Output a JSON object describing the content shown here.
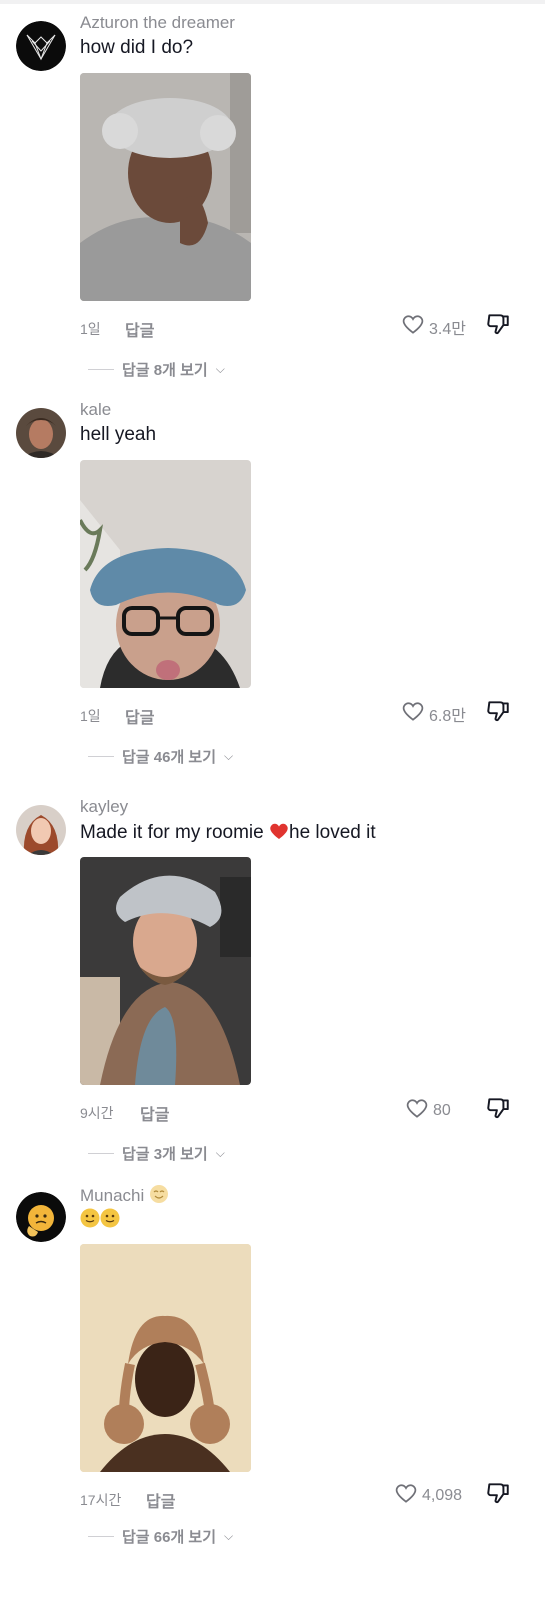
{
  "comments": [
    {
      "username": "Azturon the dreamer",
      "text": "how did I do?",
      "time": "1일",
      "reply_label": "답글",
      "likes": "3.4만",
      "view_replies": "답글 8개 보기",
      "avatar_icon": "wolf-logo-icon",
      "photo_colors": {
        "bg": "#b9b6b2",
        "skin": "#6b4a3a",
        "hat": "#cfcfcf",
        "shirt": "#9a9a9a"
      }
    },
    {
      "username": "kale",
      "text": "hell yeah",
      "time": "1일",
      "reply_label": "답글",
      "likes": "6.8만",
      "view_replies": "답글 46개 보기",
      "avatar_icon": "user-avatar",
      "photo_colors": {
        "bg": "#d7d3cf",
        "skin": "#c9a08c",
        "hat": "#5f8aa8",
        "shirt": "#2c2c2c"
      }
    },
    {
      "username": "kayley",
      "text_before": "Made it for my roomie ",
      "text_after": "he loved it",
      "time": "9시간",
      "reply_label": "답글",
      "likes": "80",
      "view_replies": "답글 3개 보기",
      "avatar_icon": "user-avatar",
      "photo_colors": {
        "bg": "#3b3a3a",
        "skin": "#d9a88e",
        "hat": "#bfc3c8",
        "shirt": "#8b6a55"
      }
    },
    {
      "username": "Munachi",
      "time": "17시간",
      "reply_label": "답글",
      "likes": "4,098",
      "view_replies": "답글 66개 보기",
      "avatar_icon": "emoji-avatar",
      "photo_colors": {
        "bg": "#e9d6b4",
        "skin": "#3b2417",
        "hat": "#b07f5a",
        "shirt": "#4a3020"
      }
    }
  ],
  "icons": {
    "like": "heart-outline-icon",
    "dislike": "thumbs-down-icon",
    "chevron": "⌵"
  },
  "colors": {
    "secondary_text": "#8a8b91",
    "primary_text": "#161823",
    "heart_red": "#e0342f"
  }
}
